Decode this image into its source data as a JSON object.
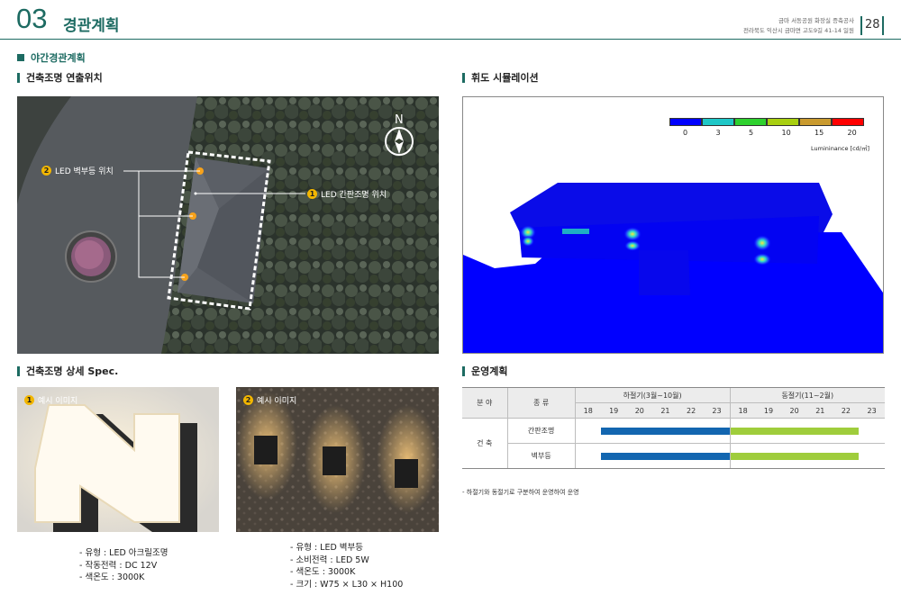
{
  "header": {
    "number": "03",
    "title": "경관계획",
    "info_line1": "금마 서동공원 화장실 증축공사",
    "info_line2": "전라북도 익산시 금마면 고도9길 41-14 일원",
    "page": "28"
  },
  "section_title": "야간경관계획",
  "left_top": {
    "title": "건축조명 연출위치",
    "label_1_num": "1",
    "label_1": "LED 간판조명 위치",
    "label_2_num": "2",
    "label_2": "LED 벽부등 위치",
    "compass": "N"
  },
  "right_top": {
    "title": "휘도 시뮬레이션",
    "legend_colors": [
      "#0000ff",
      "#1fc7c7",
      "#2ed12e",
      "#a8cf10",
      "#c99a2e",
      "#ff0000"
    ],
    "legend_ticks": [
      "0",
      "3",
      "5",
      "10",
      "15",
      "20"
    ],
    "legend_unit": "Lumininance [cd/㎡]"
  },
  "left_bottom": {
    "title": "건축조명 상세 Spec.",
    "photo1_num": "1",
    "photo1_label": "예시 이미지",
    "photo2_num": "2",
    "photo2_label": "예시 이미지",
    "spec1": [
      "- 유형 : LED 아크릴조명",
      "- 작동전력 : DC 12V",
      "- 색온도 : 3000K"
    ],
    "spec2": [
      "- 유형 : LED 벽부등",
      "- 소비전력 : LED 5W",
      "- 색온도 : 3000K",
      "- 크기 : W75 × L30 × H100"
    ]
  },
  "right_bottom": {
    "title": "운영계획",
    "col_field": "분 야",
    "col_type": "종 류",
    "summer": "하절기(3월~10월)",
    "winter": "동절기(11~2월)",
    "summer_hours": [
      "18",
      "19",
      "20",
      "21",
      "22",
      "23"
    ],
    "winter_hours": [
      "18",
      "19",
      "20",
      "21",
      "22",
      "23"
    ],
    "row_field": "건 축",
    "rows": [
      {
        "type": "간판조명",
        "summer_color": "#1366b0",
        "winter_color": "#9fcd3c"
      },
      {
        "type": "벽부등",
        "summer_color": "#1366b0",
        "winter_color": "#9fcd3c"
      }
    ],
    "note": "- 하절기와 동절기로 구분하여 운영하여 운영"
  }
}
